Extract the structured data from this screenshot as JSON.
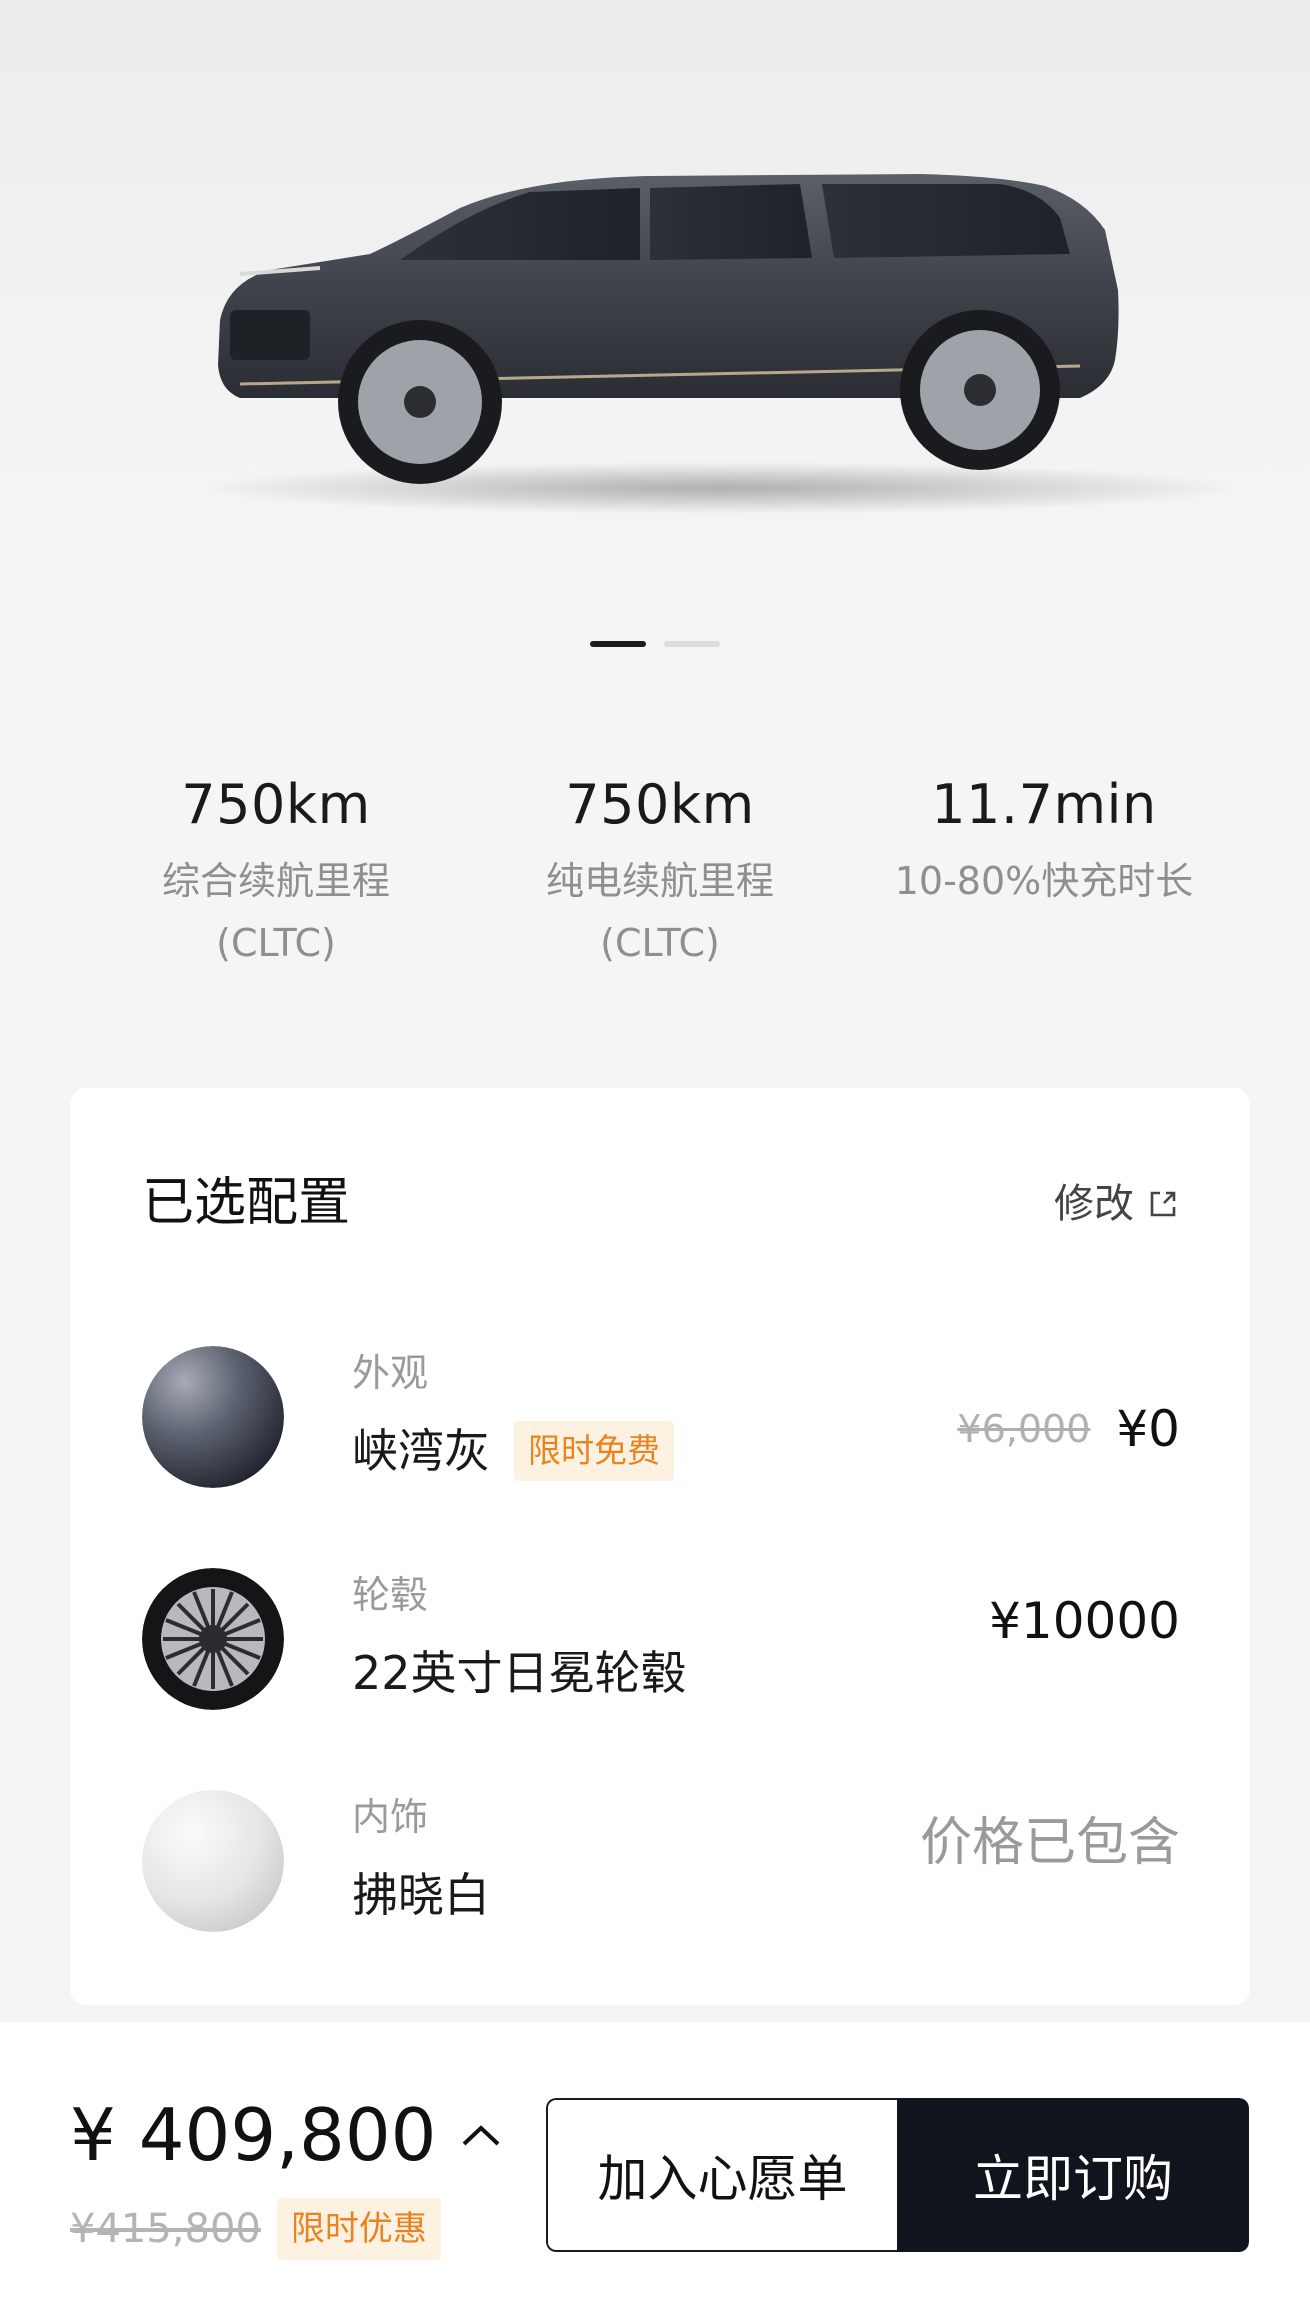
{
  "carousel": {
    "dots": 2,
    "active_index": 0
  },
  "specs": [
    {
      "value": "750km",
      "label": "综合续航里程\n(CLTC)"
    },
    {
      "value": "750km",
      "label": "纯电续航里程\n(CLTC)"
    },
    {
      "value": "11.7min",
      "label": "10-80%快充时长"
    }
  ],
  "config": {
    "title": "已选配置",
    "edit_label": "修改",
    "items": [
      {
        "category": "外观",
        "name": "峡湾灰",
        "tag": "限时免费",
        "old_price": "¥6,000",
        "price": "¥0"
      },
      {
        "category": "轮毂",
        "name": "22英寸日冕轮毂",
        "price": "¥10000"
      },
      {
        "category": "内饰",
        "name": "拂晓白",
        "price": "价格已包含"
      }
    ]
  },
  "summary": {
    "total": "¥ 409,800",
    "original": "¥415,800",
    "tag": "限时优惠",
    "wishlist_label": "加入心愿单",
    "buy_label": "立即订购"
  },
  "colors": {
    "accent_dark": "#10141d",
    "tag_bg": "#fdf1e2",
    "tag_text": "#e8841f"
  }
}
